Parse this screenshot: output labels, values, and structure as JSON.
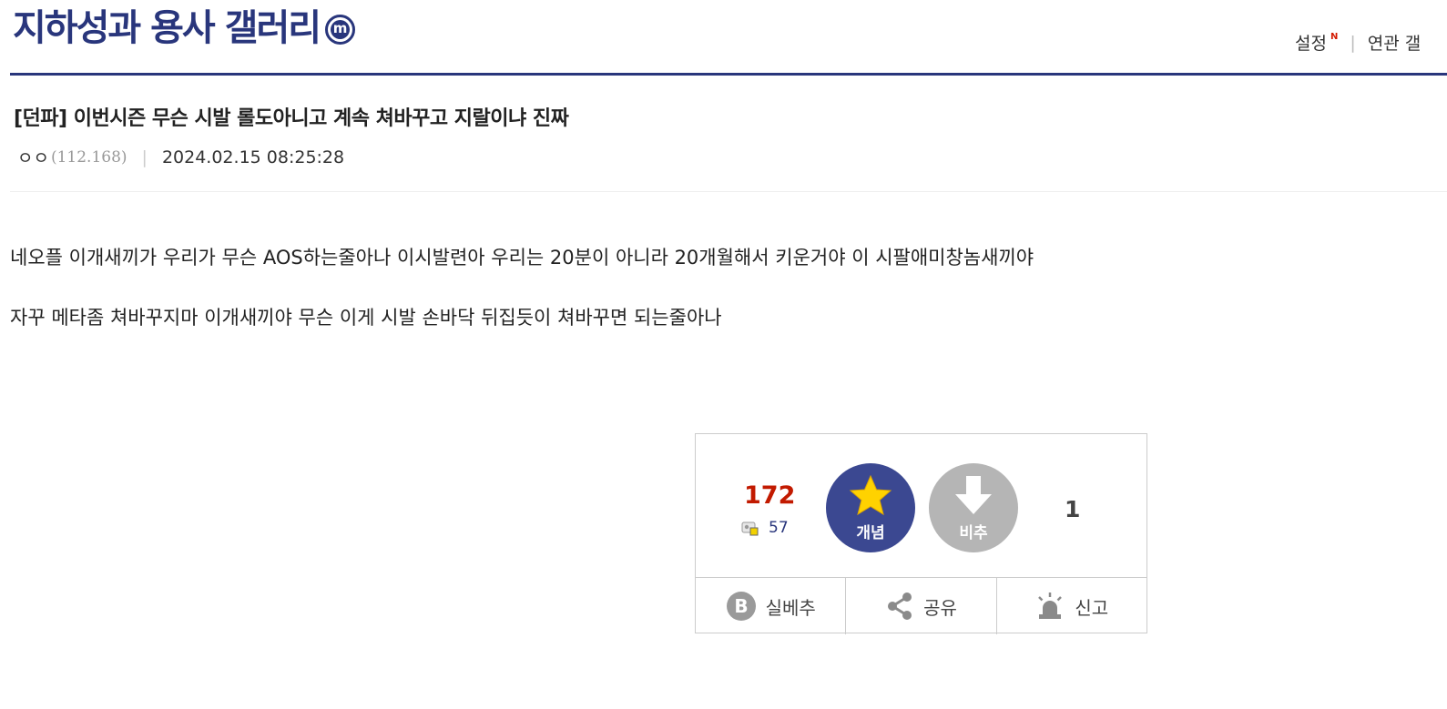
{
  "header": {
    "gallery_title": "지하성과 용사 갤러리",
    "minor_badge": "m",
    "links": {
      "settings": "설정",
      "settings_new_badge": "N",
      "related": "연관 ",
      "related_cut": "갤"
    }
  },
  "post": {
    "title": "[던파] 이번시즌 무슨 시발 롤도아니고 계속 쳐바꾸고 지랄이냐 진짜",
    "author": "ㅇㅇ",
    "ip": "(112.168)",
    "date": "2024.02.15 08:25:28",
    "body": [
      "네오플 이개새끼가 우리가 무슨 AOS하는줄아나 이시발련아 우리는 20분이 아니라 20개월해서 키운거야 이 시팔애미창놈새끼야",
      "자꾸 메타좀 쳐바꾸지마 이개새끼야 무슨 이게 시발 손바닥 뒤집듯이 쳐바꾸면 되는줄아나"
    ]
  },
  "vote": {
    "up_count": "172",
    "fixed_count": "57",
    "up_label": "개념",
    "down_label": "비추",
    "down_count": "1",
    "best_label": "실베추",
    "share_label": "공유",
    "report_label": "신고"
  },
  "colors": {
    "brand": "#29367c",
    "up_count": "#c21a00",
    "up_button": "#3b4891",
    "down_button": "#b5b5b5"
  },
  "icons": {
    "up": "star-icon",
    "down": "arrow-down-icon",
    "best": "b-circle-icon",
    "share": "share-icon",
    "report": "siren-icon",
    "fixed": "fixed-user-icon"
  }
}
